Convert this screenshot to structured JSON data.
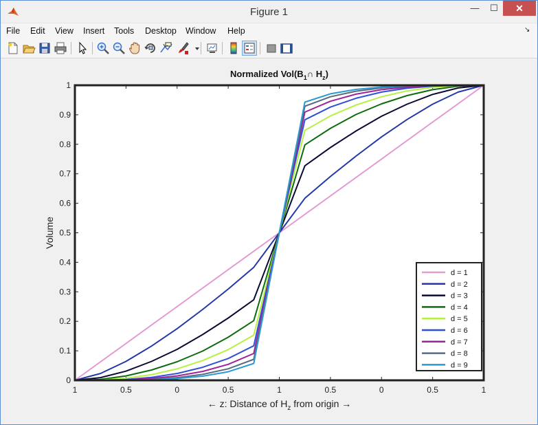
{
  "window": {
    "title": "Figure 1",
    "minimize": "—",
    "maximize": "☐",
    "close": "✕"
  },
  "menu": {
    "items": [
      "File",
      "Edit",
      "View",
      "Insert",
      "Tools",
      "Desktop",
      "Window",
      "Help"
    ],
    "overflow": "↘"
  },
  "toolbar": {
    "buttons": [
      {
        "name": "new-figure-icon",
        "color": "#f2f2f2"
      },
      {
        "name": "open-file-icon",
        "color": "#e8b84a"
      },
      {
        "name": "save-icon",
        "color": "#3a5fa8"
      },
      {
        "name": "print-icon",
        "color": "#777777"
      },
      {
        "name": "pointer-icon",
        "color": "#000000"
      },
      {
        "name": "zoom-in-icon",
        "color": "#3a6fc9"
      },
      {
        "name": "zoom-out-icon",
        "color": "#3a6fc9"
      },
      {
        "name": "pan-icon",
        "color": "#c8a070"
      },
      {
        "name": "rotate-3d-icon",
        "color": "#444444"
      },
      {
        "name": "data-cursor-icon",
        "color": "#333333"
      },
      {
        "name": "brush-icon",
        "color": "#cc2222"
      },
      {
        "name": "link-plot-icon",
        "color": "#555555"
      },
      {
        "name": "colorbar-icon",
        "color": "#e8c040"
      },
      {
        "name": "legend-icon",
        "color": "#3a6fc9"
      },
      {
        "name": "hide-plot-tools-icon",
        "color": "#777777"
      },
      {
        "name": "show-plot-tools-icon",
        "color": "#2a4f90"
      }
    ]
  },
  "chart_data": {
    "type": "line",
    "title": "Normalized Vol(B",
    "title_sub1": "1",
    "title_mid": "∩ H",
    "title_sub2": "z",
    "title_end": ")",
    "ylabel": "Volume",
    "xlabel_prefix": "←  z: Distance of H",
    "xlabel_sub": "z",
    "xlabel_suffix": " from origin →",
    "x": [
      -1,
      -0.875,
      -0.75,
      -0.625,
      -0.5,
      -0.375,
      -0.25,
      -0.125,
      0,
      0.125,
      0.25,
      0.375,
      0.5,
      0.625,
      0.75,
      0.875,
      1
    ],
    "xlim": [
      -1,
      1
    ],
    "ylim": [
      0,
      1
    ],
    "xtick_values": [
      -1,
      -0.75,
      -0.5,
      -0.25,
      0,
      0.25,
      0.5,
      0.75,
      1
    ],
    "xtick_labels": [
      "1",
      "0.5",
      "0",
      "0.5",
      "1",
      "0.5",
      "0",
      "0.5",
      "1"
    ],
    "ytick_values": [
      0,
      0.1,
      0.2,
      0.3,
      0.4,
      0.5,
      0.6,
      0.7,
      0.8,
      0.9,
      1
    ],
    "ytick_labels": [
      "0",
      "0.1",
      "0.2",
      "0.3",
      "0.4",
      "0.5",
      "0.6",
      "0.7",
      "0.8",
      "0.9",
      "1"
    ],
    "legend_location": "bottom-right",
    "grid": false,
    "series": [
      {
        "name": "d = 1",
        "color": "#e39bd5",
        "values": [
          0,
          0.0625,
          0.125,
          0.1875,
          0.25,
          0.3125,
          0.375,
          0.4375,
          0.5,
          0.5625,
          0.625,
          0.6875,
          0.75,
          0.8125,
          0.875,
          0.9375,
          1
        ]
      },
      {
        "name": "d = 2",
        "color": "#2238a8",
        "values": [
          0,
          0.023,
          0.064,
          0.116,
          0.175,
          0.24,
          0.309,
          0.383,
          0.5,
          0.617,
          0.691,
          0.76,
          0.825,
          0.884,
          0.936,
          0.977,
          1
        ]
      },
      {
        "name": "d = 3",
        "color": "#0a0a32",
        "values": [
          0,
          0.009,
          0.031,
          0.064,
          0.105,
          0.155,
          0.211,
          0.273,
          0.5,
          0.727,
          0.789,
          0.845,
          0.895,
          0.936,
          0.969,
          0.991,
          1
        ]
      },
      {
        "name": "d = 4",
        "color": "#0d6b0d",
        "values": [
          0,
          0.003,
          0.015,
          0.035,
          0.063,
          0.099,
          0.146,
          0.202,
          0.5,
          0.798,
          0.854,
          0.901,
          0.937,
          0.965,
          0.985,
          0.997,
          1
        ]
      },
      {
        "name": "d = 5",
        "color": "#b8f040",
        "values": [
          0,
          0.001,
          0.007,
          0.019,
          0.039,
          0.067,
          0.104,
          0.153,
          0.5,
          0.847,
          0.896,
          0.933,
          0.961,
          0.981,
          0.993,
          0.999,
          1
        ]
      },
      {
        "name": "d = 6",
        "color": "#3050d8",
        "values": [
          0,
          0.0005,
          0.003,
          0.01,
          0.023,
          0.044,
          0.074,
          0.117,
          0.5,
          0.883,
          0.926,
          0.956,
          0.977,
          0.99,
          0.997,
          0.9995,
          1
        ]
      },
      {
        "name": "d = 7",
        "color": "#a0229a",
        "values": [
          0,
          0.0002,
          0.0015,
          0.006,
          0.015,
          0.03,
          0.054,
          0.091,
          0.5,
          0.909,
          0.946,
          0.97,
          0.985,
          0.994,
          0.9985,
          0.9998,
          1
        ]
      },
      {
        "name": "d = 8",
        "color": "#5a6a80",
        "values": [
          0,
          0.0001,
          0.0008,
          0.003,
          0.009,
          0.02,
          0.039,
          0.071,
          0.5,
          0.929,
          0.961,
          0.98,
          0.991,
          0.997,
          0.9992,
          0.9999,
          1
        ]
      },
      {
        "name": "d = 9",
        "color": "#2a9ad0",
        "values": [
          0,
          0,
          0.0004,
          0.002,
          0.006,
          0.014,
          0.029,
          0.057,
          0.5,
          0.943,
          0.971,
          0.986,
          0.994,
          0.998,
          0.9996,
          1,
          1
        ]
      }
    ]
  }
}
